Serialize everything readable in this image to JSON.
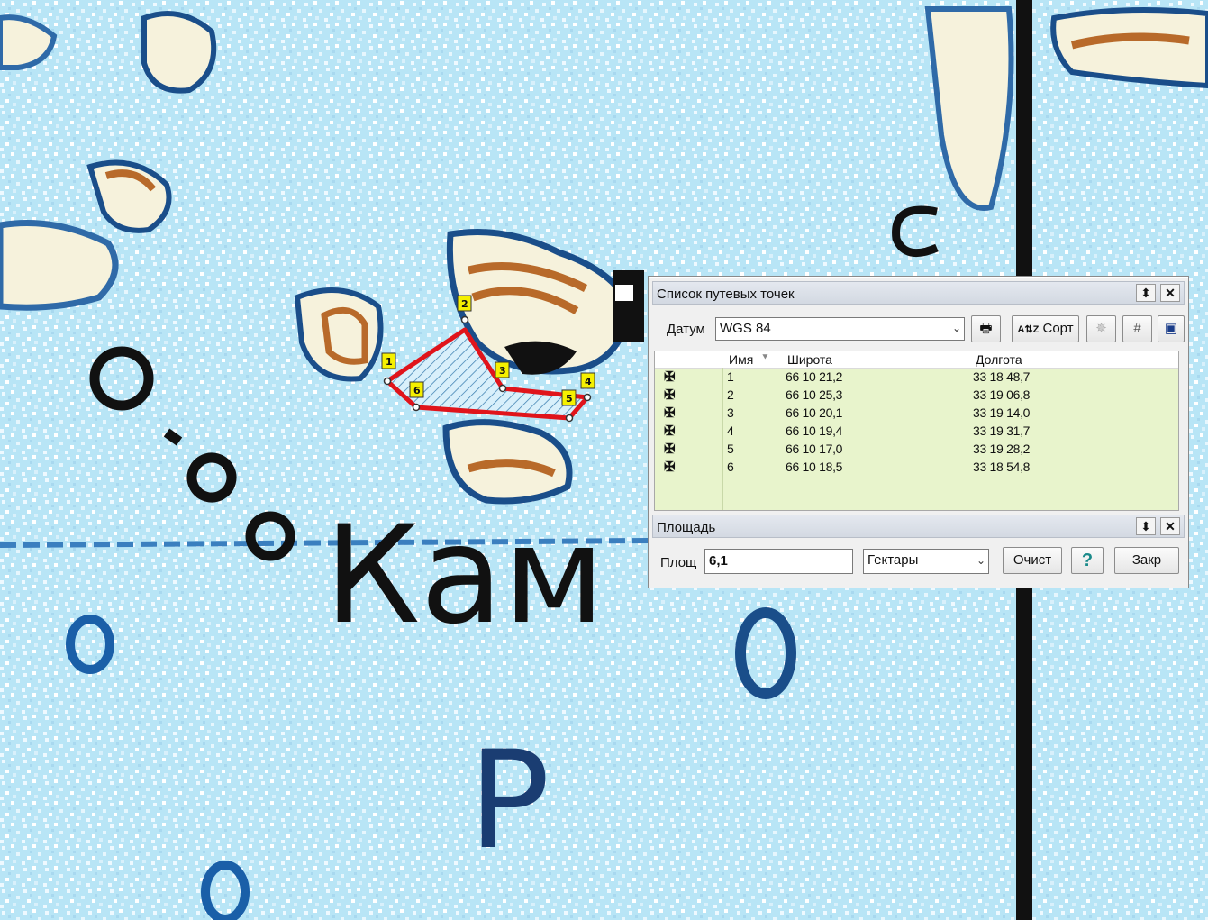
{
  "map": {
    "label_main": "Кам",
    "label_p": "Р",
    "polygon_points": [
      "1",
      "2",
      "3",
      "4",
      "5",
      "6"
    ]
  },
  "waypoints_panel": {
    "title": "Список путевых точек",
    "pin_icon": "pin-icon",
    "close_icon": "close-icon",
    "datum_label": "Датум",
    "datum_value": "WGS 84",
    "sort_button": "Сорт",
    "columns": {
      "name": "Имя",
      "lat": "Широта",
      "lon": "Долгота"
    },
    "rows": [
      {
        "name": "1",
        "lat": "66 10 21,2",
        "lon": "33 18 48,7"
      },
      {
        "name": "2",
        "lat": "66 10 25,3",
        "lon": "33 19 06,8"
      },
      {
        "name": "3",
        "lat": "66 10 20,1",
        "lon": "33 19 14,0"
      },
      {
        "name": "4",
        "lat": "66 10 19,4",
        "lon": "33 19 31,7"
      },
      {
        "name": "5",
        "lat": "66 10 17,0",
        "lon": "33 19 28,2"
      },
      {
        "name": "6",
        "lat": "66 10 18,5",
        "lon": "33 18 54,8"
      }
    ]
  },
  "area_panel": {
    "title": "Площадь",
    "area_label": "Площ",
    "area_value": "6,1",
    "unit_value": "Гектары",
    "clear_button": "Очист",
    "help_button": "?",
    "close_button": "Закр"
  },
  "colors": {
    "water": "#b9e6f7",
    "contour": "#1f5fa8",
    "polygon": "#e0141b",
    "marker": "#f5f000",
    "grid_bg": "#e8f4cc"
  }
}
